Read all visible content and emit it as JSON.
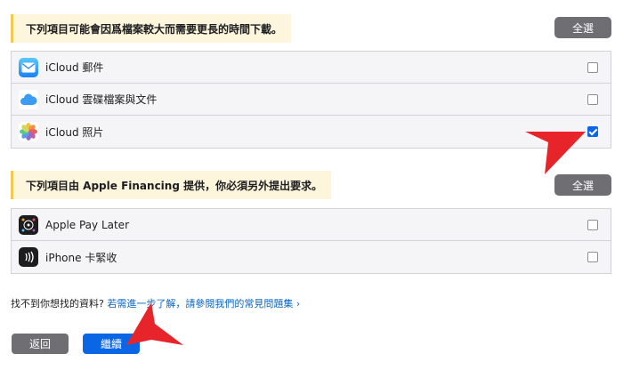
{
  "sections": [
    {
      "title": "下列項目可能會因爲檔案較大而需要更長的時間下載。",
      "select_all": "全選",
      "items": [
        {
          "label": "iCloud 郵件",
          "icon": "mail-icon",
          "checked": false
        },
        {
          "label": "iCloud 雲碟檔案與文件",
          "icon": "icloud-drive-icon",
          "checked": false
        },
        {
          "label": "iCloud 照片",
          "icon": "photos-icon",
          "checked": true
        }
      ]
    },
    {
      "title": "下列項目由 Apple Financing 提供，你必須另外提出要求。",
      "select_all": "全選",
      "items": [
        {
          "label": "Apple Pay Later",
          "icon": "apple-pay-later-icon",
          "checked": false
        },
        {
          "label": "iPhone 卡緊收",
          "icon": "tap-to-pay-icon",
          "checked": false
        }
      ]
    }
  ],
  "help": {
    "text": "找不到你想找的資料?",
    "link": "若需進一步了解，請參閱我們的常見問題集 ›"
  },
  "buttons": {
    "back": "返回",
    "continue": "繼續"
  },
  "colors": {
    "accent": "#0a66e4",
    "header_bg": "#fdf6dc",
    "header_bar": "#f2c94c",
    "annotation_arrow": "#e8242b"
  }
}
